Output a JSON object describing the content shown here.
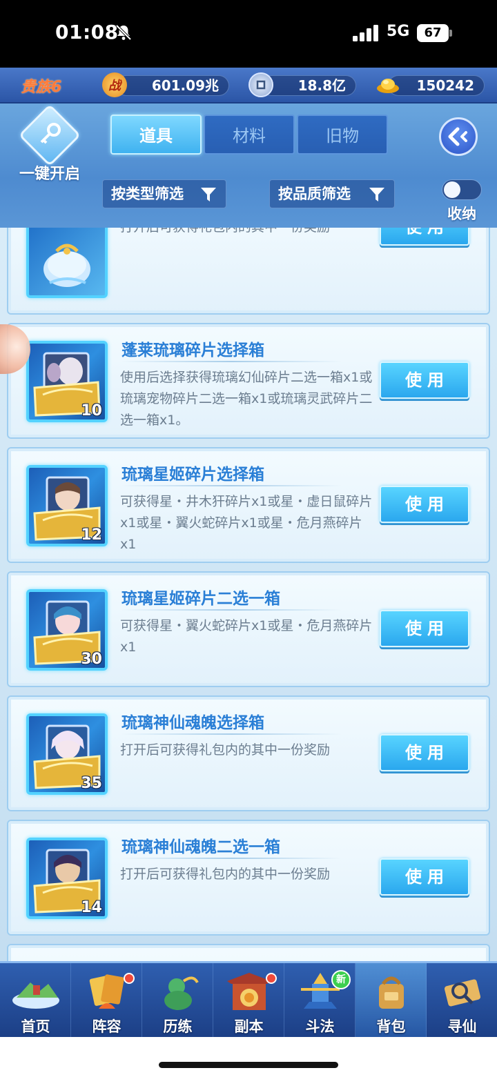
{
  "status_bar": {
    "time": "01:08",
    "network": "5G",
    "battery": "67"
  },
  "resources": {
    "vip_label": "贵族6",
    "power_icon": "战",
    "power": "601.09兆",
    "silver": "18.8亿",
    "gold": "150242"
  },
  "header": {
    "one_key_label": "一键开启",
    "tabs": [
      {
        "label": "道具",
        "active": true
      },
      {
        "label": "材料",
        "active": false
      },
      {
        "label": "旧物",
        "active": false
      }
    ],
    "filter_type": "按类型筛选",
    "filter_quality": "按品质筛选",
    "collapse_label": "收纳"
  },
  "items": [
    {
      "title": "",
      "desc": "打开后可获得礼包内的其中一份奖励",
      "count": "",
      "button": "使用",
      "icon": "gift-bag-icon"
    },
    {
      "title": "蓬莱琉璃碎片选择箱",
      "desc": "使用后选择获得琉璃幻仙碎片二选一箱x1或琉璃宠物碎片二选一箱x1或琉璃灵武碎片二选一箱x1。",
      "count": "10",
      "button": "使用",
      "icon": "treasure-chest-icon"
    },
    {
      "title": "琉璃星姬碎片选择箱",
      "desc": "可获得星・井木犴碎片x1或星・虚日鼠碎片x1或星・翼火蛇碎片x1或星・危月燕碎片x1",
      "count": "12",
      "button": "使用",
      "icon": "treasure-chest-icon"
    },
    {
      "title": "琉璃星姬碎片二选一箱",
      "desc": "可获得星・翼火蛇碎片x1或星・危月燕碎片x1",
      "count": "30",
      "button": "使用",
      "icon": "treasure-chest-icon"
    },
    {
      "title": "琉璃神仙魂魄选择箱",
      "desc": "打开后可获得礼包内的其中一份奖励",
      "count": "35",
      "button": "使用",
      "icon": "treasure-chest-icon"
    },
    {
      "title": "琉璃神仙魂魄二选一箱",
      "desc": "打开后可获得礼包内的其中一份奖励",
      "count": "14",
      "button": "使用",
      "icon": "treasure-chest-icon"
    }
  ],
  "bottom_nav": [
    {
      "label": "首页",
      "icon": "home-island-icon",
      "badge": ""
    },
    {
      "label": "阵容",
      "icon": "lineup-cards-icon",
      "badge": "dot"
    },
    {
      "label": "历练",
      "icon": "training-gourd-icon",
      "badge": ""
    },
    {
      "label": "副本",
      "icon": "dungeon-gate-icon",
      "badge": "dot"
    },
    {
      "label": "斗法",
      "icon": "battle-tower-icon",
      "badge": "新"
    },
    {
      "label": "背包",
      "icon": "backpack-icon",
      "badge": "",
      "active": true
    },
    {
      "label": "寻仙",
      "icon": "seek-scroll-icon",
      "badge": ""
    }
  ],
  "colors": {
    "title_blue": "#2a7fd6",
    "button_blue": "#2aa7ee",
    "vip_orange": "#ff7b3a",
    "badge_red": "#f04a3b",
    "badge_green": "#3ccf4e"
  }
}
